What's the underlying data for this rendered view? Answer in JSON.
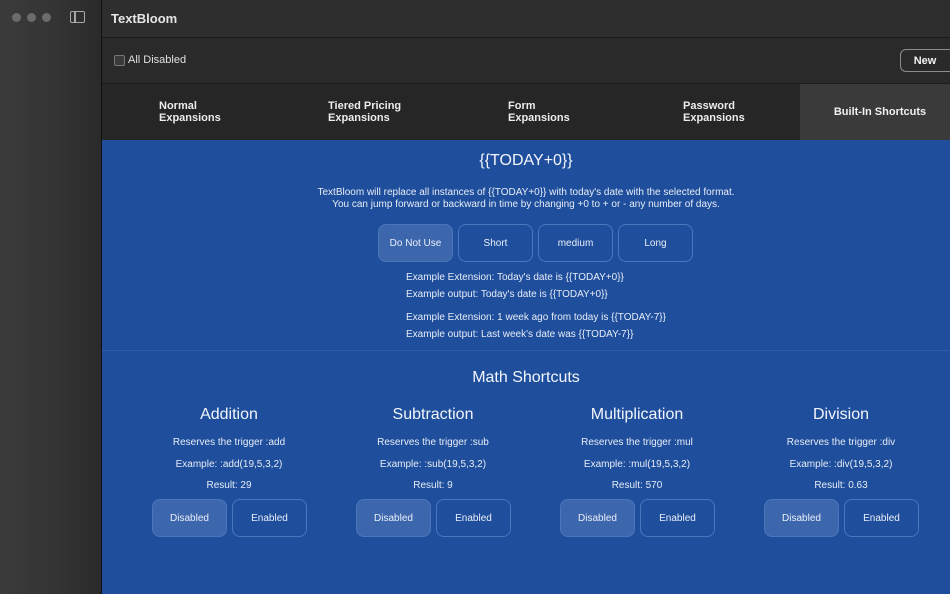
{
  "window": {
    "app_title": "TextBloom"
  },
  "toolbar": {
    "all_disabled_label": "All Disabled",
    "new_label": "New"
  },
  "tabs": [
    {
      "line1": "Normal",
      "line2": "Expansions"
    },
    {
      "line1": "Tiered Pricing",
      "line2": "Expansions"
    },
    {
      "line1": "Form",
      "line2": "Expansions"
    },
    {
      "line1": "Password",
      "line2": "Expansions"
    },
    {
      "line1": "Built-In Shortcuts",
      "line2": ""
    }
  ],
  "date": {
    "title": "{{TODAY+0}}",
    "desc1": "TextBloom will replace all instances of {{TODAY+0}} with today's date with the selected format.",
    "desc2": "You can jump forward or backward in time by changing +0 to + or - any number of days.",
    "formats": [
      "Do Not Use",
      "Short",
      "medium",
      "Long"
    ],
    "selected_format": "Do Not Use",
    "ex1": "Example Extension: Today's date is {{TODAY+0}}",
    "ex2": "Example output: Today's date is {{TODAY+0}}",
    "ex3": "Example Extension: 1 week ago from today is {{TODAY-7}}",
    "ex4": "Example output: Last week's date was {{TODAY-7}}"
  },
  "math": {
    "title": "Math Shortcuts",
    "columns": [
      {
        "title": "Addition",
        "trigger": "Reserves the trigger :add",
        "example": "Example: :add(19,5,3,2)",
        "result": "Result: 29",
        "disabled": "Disabled",
        "enabled": "Enabled"
      },
      {
        "title": "Subtraction",
        "trigger": "Reserves the trigger :sub",
        "example": "Example: :sub(19,5,3,2)",
        "result": "Result: 9",
        "disabled": "Disabled",
        "enabled": "Enabled"
      },
      {
        "title": "Multiplication",
        "trigger": "Reserves the trigger :mul",
        "example": "Example: :mul(19,5,3,2)",
        "result": "Result: 570",
        "disabled": "Disabled",
        "enabled": "Enabled"
      },
      {
        "title": "Division",
        "trigger": "Reserves the trigger :div",
        "example": "Example: :div(19,5,3,2)",
        "result": "Result: 0.63",
        "disabled": "Disabled",
        "enabled": "Enabled"
      }
    ]
  },
  "colors": {
    "background": "#1f4f9c",
    "selected_button": "#3d67ad"
  }
}
